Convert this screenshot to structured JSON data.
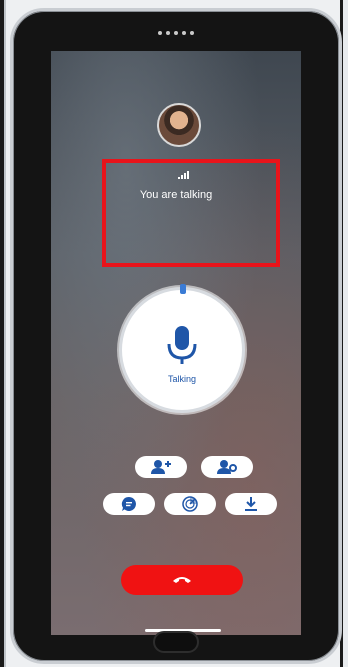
{
  "call": {
    "status": "You are talking",
    "talk_label": "Talking"
  },
  "actions": [
    {
      "name": "add-participant",
      "icon": "person-add-icon"
    },
    {
      "name": "contact-settings",
      "icon": "person-gear-icon"
    },
    {
      "name": "chat",
      "icon": "chat-icon"
    },
    {
      "name": "radar",
      "icon": "radar-icon"
    },
    {
      "name": "download",
      "icon": "download-icon"
    }
  ],
  "end_call": {
    "icon": "hang-up-icon"
  },
  "colors": {
    "accent": "#1f56a8",
    "end_call": "#f01212",
    "highlight": "#e8141b"
  }
}
